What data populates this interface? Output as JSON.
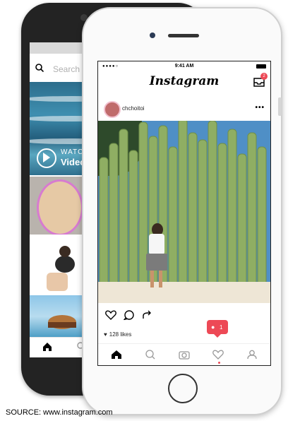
{
  "back_phone": {
    "search_placeholder": "Search",
    "watch_label": "WATCH",
    "videos_label": "Video"
  },
  "front_phone": {
    "status_time": "9:41 AM",
    "app_logo": "Instagram",
    "inbox_badge": "2",
    "post": {
      "username": "chchoitoi",
      "likes": "128 likes"
    },
    "notification_count": "1"
  },
  "caption": "SOURCE: www.instagram.com",
  "colors": {
    "accent_red": "#ed4956",
    "phone_back": "#232323",
    "phone_front": "#fafafa"
  }
}
